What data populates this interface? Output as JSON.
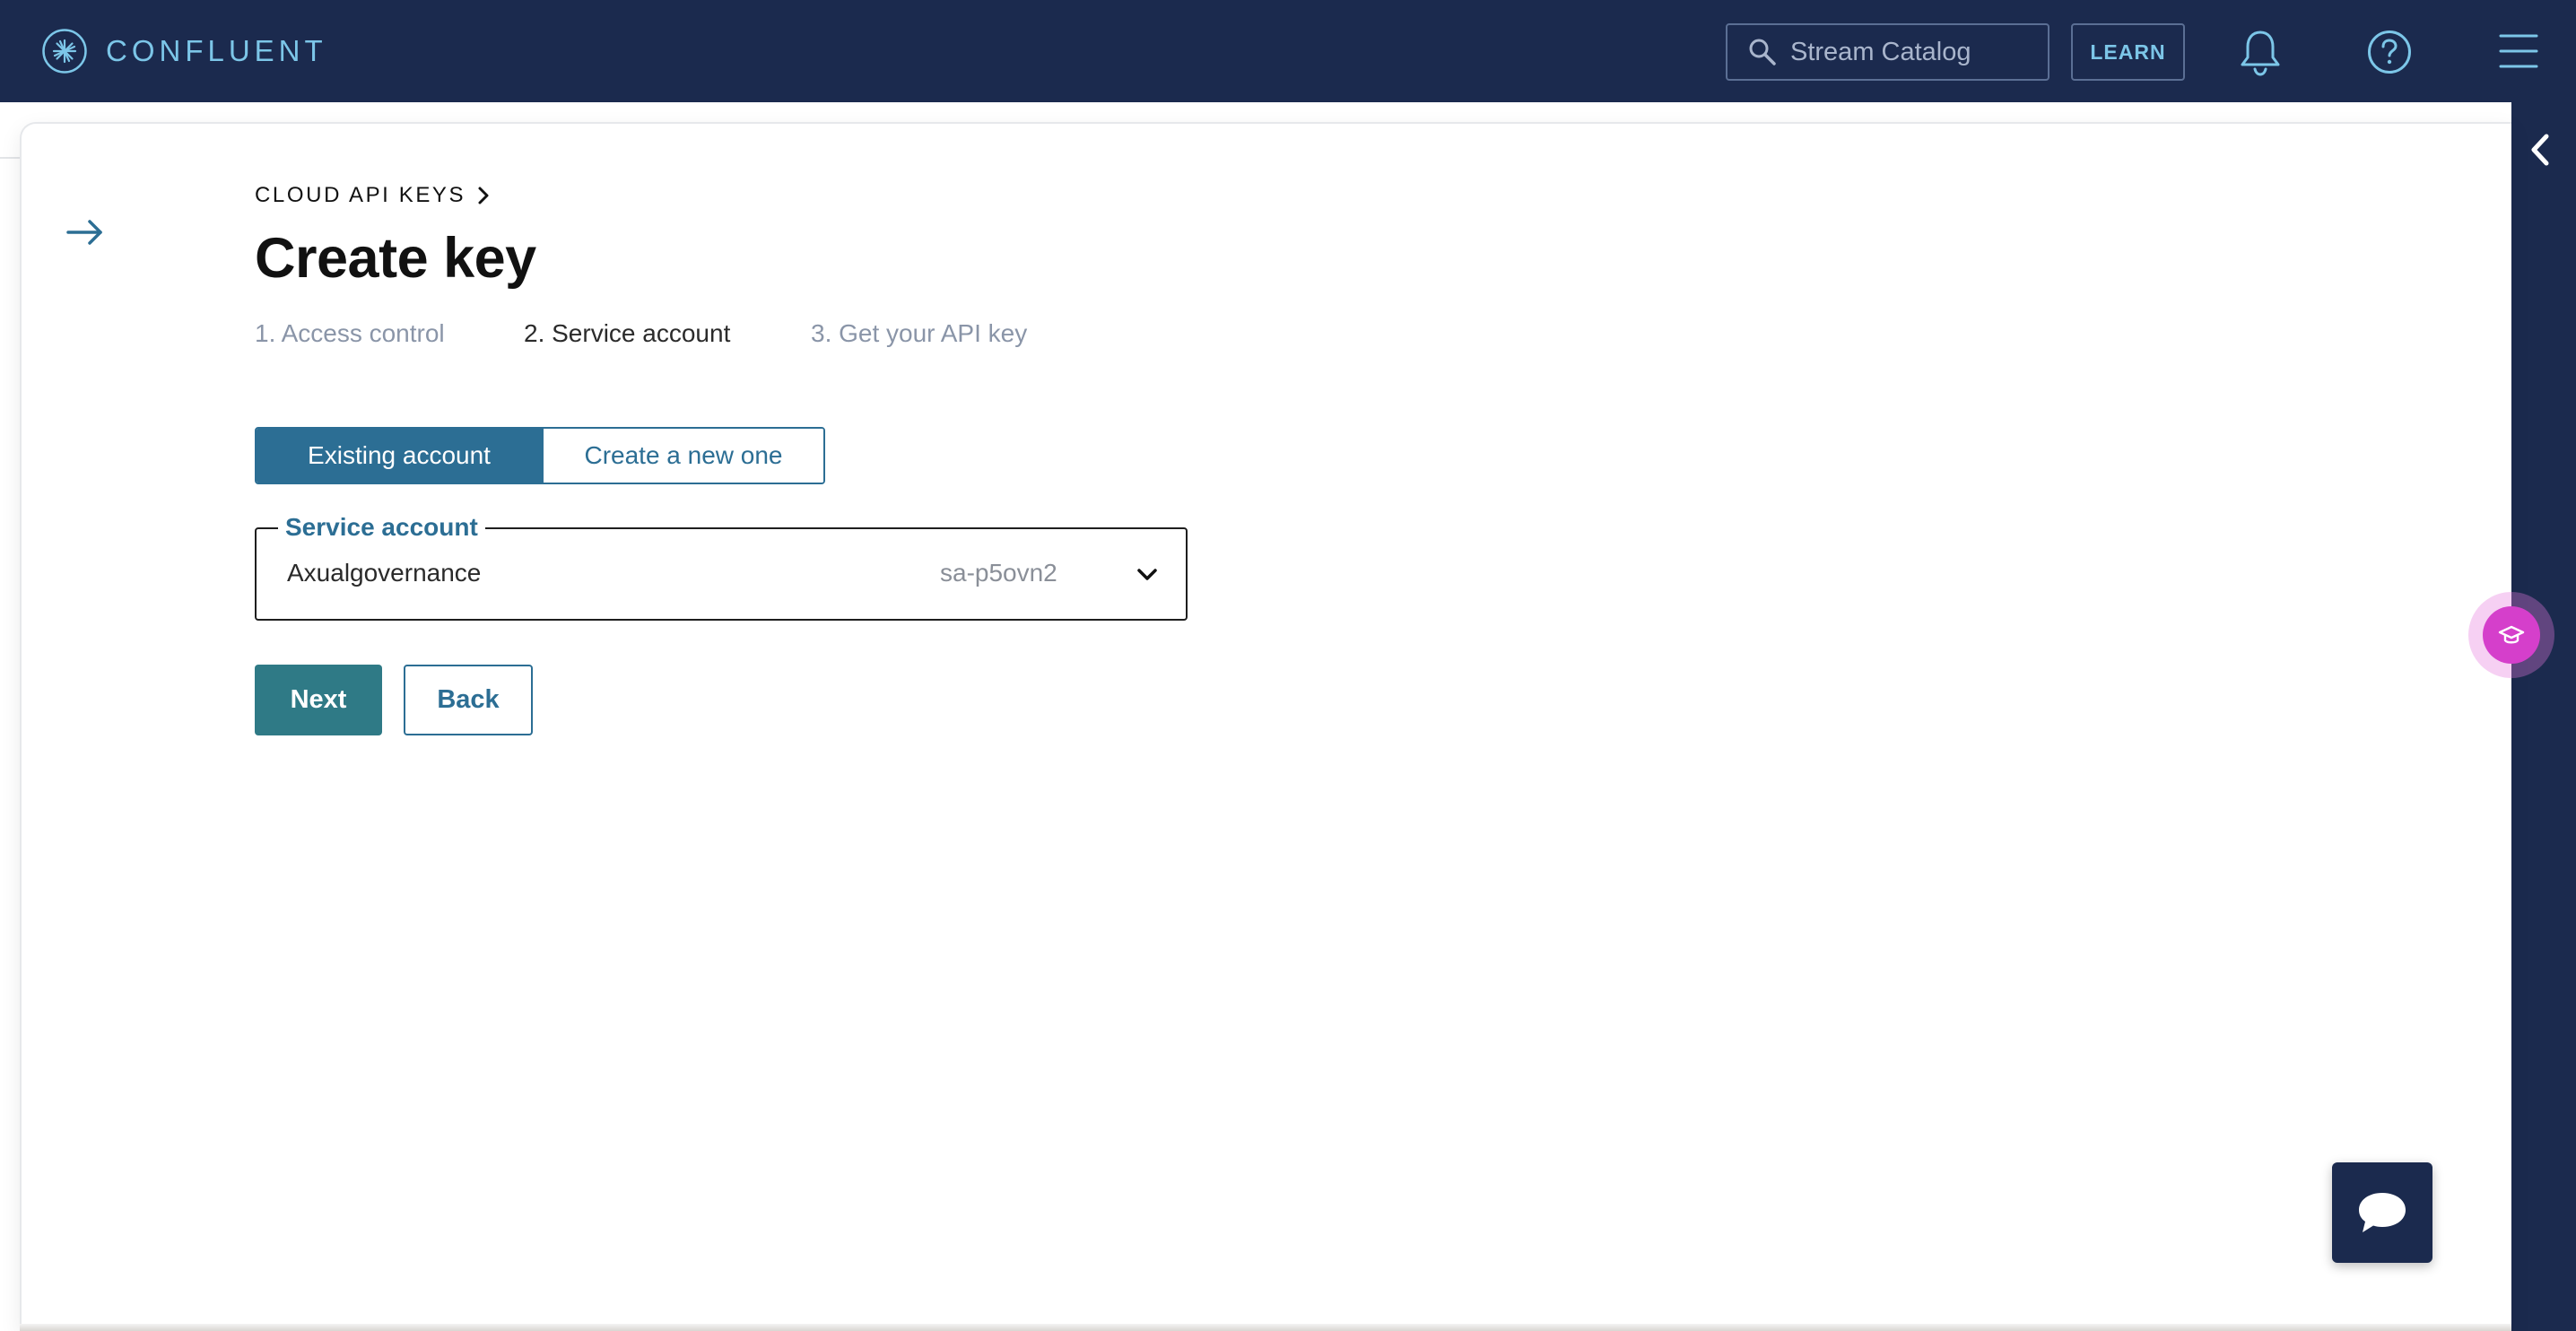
{
  "brand": {
    "name": "CONFLUENT"
  },
  "header": {
    "search_placeholder": "Stream Catalog",
    "learn_label": "LEARN"
  },
  "breadcrumb": {
    "label": "CLOUD API KEYS"
  },
  "page": {
    "title": "Create key"
  },
  "steps": [
    {
      "label": "1. Access control",
      "active": false
    },
    {
      "label": "2. Service account",
      "active": true
    },
    {
      "label": "3. Get your API key",
      "active": false
    }
  ],
  "account_toggle": {
    "existing_label": "Existing account",
    "new_label": "Create a new one",
    "selected": "existing"
  },
  "service_account": {
    "legend": "Service account",
    "value": "Axualgovernance",
    "id": "sa-p5ovn2"
  },
  "actions": {
    "next_label": "Next",
    "back_label": "Back"
  },
  "colors": {
    "nav_bg": "#1b2a4e",
    "accent": "#2c6e94",
    "primary_button": "#2f7a86",
    "learn_fab": "#d53fcb"
  }
}
